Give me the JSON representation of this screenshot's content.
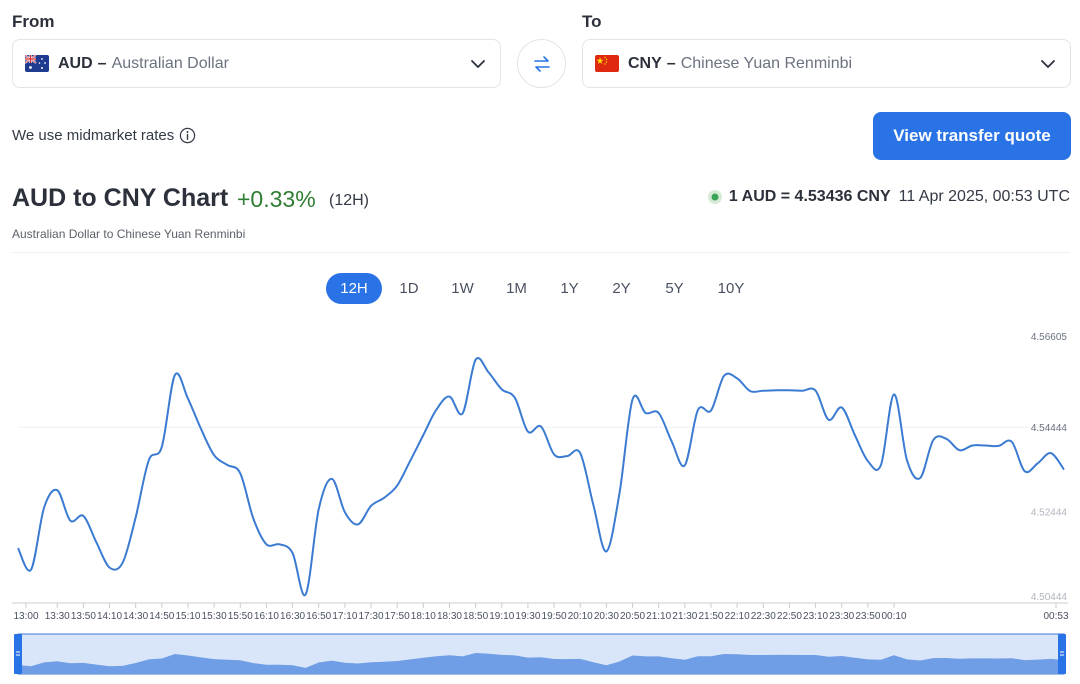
{
  "from": {
    "label": "From",
    "code": "AUD",
    "dash": "–",
    "name": "Australian Dollar"
  },
  "to": {
    "label": "To",
    "code": "CNY",
    "dash": "–",
    "name": "Chinese Yuan Renminbi"
  },
  "midmarket_text": "We use midmarket rates",
  "quote_button": "View transfer quote",
  "header": {
    "title": "AUD to CNY Chart",
    "change": "+0.33%",
    "period": "(12H)",
    "subtitle": "Australian Dollar to Chinese Yuan Renminbi",
    "rate": "1 AUD = 4.53436 CNY",
    "timestamp": "11 Apr 2025, 00:53 UTC"
  },
  "ranges": [
    {
      "label": "12H",
      "active": true
    },
    {
      "label": "1D",
      "active": false
    },
    {
      "label": "1W",
      "active": false
    },
    {
      "label": "1M",
      "active": false
    },
    {
      "label": "1Y",
      "active": false
    },
    {
      "label": "2Y",
      "active": false
    },
    {
      "label": "5Y",
      "active": false
    },
    {
      "label": "10Y",
      "active": false
    }
  ],
  "colors": {
    "accent": "#2a73e6",
    "line": "#3b7bd1",
    "positive": "#2e7d32",
    "navigator_fill": "#6f9de6",
    "navigator_bg": "#d9e6f9"
  },
  "chart_data": {
    "type": "line",
    "ylim": [
      4.50444,
      4.56605
    ],
    "yticks": [
      "4.56605",
      "4.54444",
      "4.52444",
      "4.50444"
    ],
    "ytick_values": [
      4.56605,
      4.54444,
      4.52444,
      4.50444
    ],
    "x_start": "13:00",
    "x_step_minutes": 10,
    "xticks": [
      "13:00",
      "13:30",
      "13:50",
      "14:10",
      "14:30",
      "14:50",
      "15:10",
      "15:30",
      "15:50",
      "16:10",
      "16:30",
      "16:50",
      "17:10",
      "17:30",
      "17:50",
      "18:10",
      "18:30",
      "18:50",
      "19:10",
      "19:30",
      "19:50",
      "20:10",
      "20:30",
      "20:50",
      "21:10",
      "21:30",
      "21:50",
      "22:10",
      "22:30",
      "22:50",
      "23:10",
      "23:30",
      "23:50",
      "00:10",
      "00:53"
    ],
    "series": [
      {
        "values": [
          4.5158,
          4.5107,
          4.5254,
          4.5295,
          4.5223,
          4.5234,
          4.5171,
          4.5112,
          4.5123,
          4.5231,
          4.5366,
          4.5398,
          4.5568,
          4.5512,
          4.544,
          4.5378,
          4.5355,
          4.5335,
          4.5228,
          4.5167,
          4.5167,
          4.5146,
          4.5048,
          4.525,
          4.5322,
          4.5243,
          4.5214,
          4.5258,
          4.5277,
          4.5306,
          4.5365,
          4.5426,
          4.5486,
          4.5517,
          4.5477,
          4.5604,
          4.5574,
          4.5534,
          4.5514,
          4.5434,
          4.5446,
          4.538,
          4.5376,
          4.5383,
          4.5261,
          4.515,
          4.5288,
          4.551,
          4.5478,
          4.5478,
          4.541,
          4.5354,
          4.5485,
          4.5484,
          4.5566,
          4.556,
          4.553,
          4.5531,
          4.5532,
          4.5532,
          4.5531,
          4.5531,
          4.5462,
          4.5491,
          4.5426,
          4.5364,
          4.5355,
          4.5522,
          4.5365,
          4.5324,
          4.5414,
          4.5417,
          4.539,
          4.5401,
          4.5401,
          4.54,
          4.541,
          4.534,
          4.5359,
          4.5383,
          4.5344
        ]
      }
    ]
  }
}
